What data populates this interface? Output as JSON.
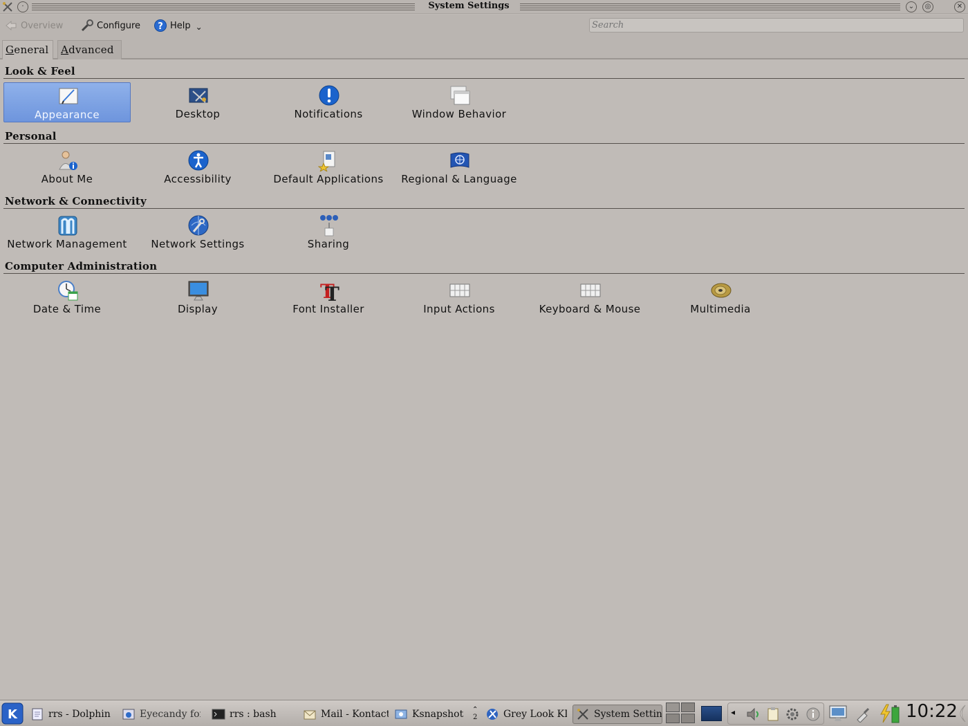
{
  "window": {
    "title": "System Settings"
  },
  "toolbar": {
    "overview": "Overview",
    "configure": "Configure",
    "help": "Help",
    "help_arrow": "⌄",
    "search_placeholder": "Search"
  },
  "tabs": [
    {
      "label_pre": "",
      "label_u": "G",
      "label_post": "eneral"
    },
    {
      "label_pre": "",
      "label_u": "A",
      "label_post": "dvanced"
    }
  ],
  "sections": {
    "look_feel": {
      "title": "Look & Feel",
      "items": [
        "Appearance",
        "Desktop",
        "Notifications",
        "Window Behavior"
      ]
    },
    "personal": {
      "title": "Personal",
      "items": [
        "About Me",
        "Accessibility",
        "Default Applications",
        "Regional & Language"
      ]
    },
    "network": {
      "title": "Network & Connectivity",
      "items": [
        "Network Management",
        "Network Settings",
        "Sharing"
      ]
    },
    "admin": {
      "title": "Computer Administration",
      "items": [
        "Date & Time",
        "Display",
        "Font Installer",
        "Input Actions",
        "Keyboard & Mouse",
        "Multimedia"
      ]
    }
  },
  "taskbar": {
    "tasks": [
      "rrs - Dolphin",
      "Eyecandy for",
      "rrs : bash",
      "Mail - Kontact",
      "Ksnapshot",
      "Grey Look KD",
      "System Settin"
    ],
    "desktop_number": "2",
    "clock": "10:22"
  }
}
